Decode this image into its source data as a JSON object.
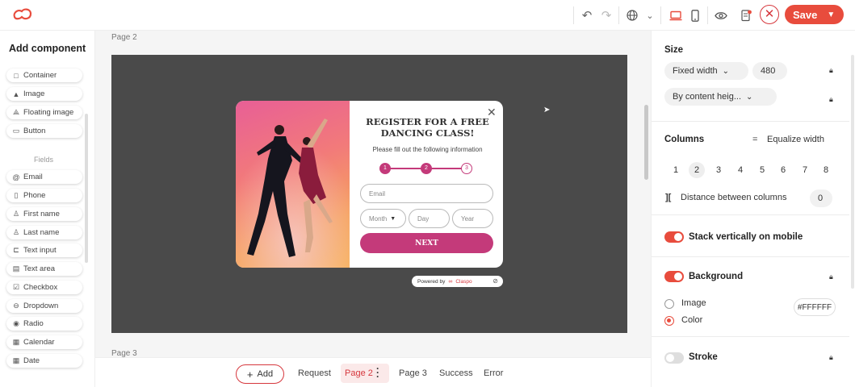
{
  "topbar": {
    "save_label": "Save",
    "brand_color": "#e84c3d"
  },
  "left_panel": {
    "title": "Add component",
    "components": [
      {
        "label": "Container",
        "icon": "square-icon"
      },
      {
        "label": "Image",
        "icon": "image-icon"
      },
      {
        "label": "Floating image",
        "icon": "floating-image-icon"
      },
      {
        "label": "Button",
        "icon": "button-icon"
      }
    ],
    "fields_label": "Fields",
    "fields": [
      {
        "label": "Email",
        "icon": "at-icon"
      },
      {
        "label": "Phone",
        "icon": "phone-icon"
      },
      {
        "label": "First name",
        "icon": "person-icon"
      },
      {
        "label": "Last name",
        "icon": "person-icon"
      },
      {
        "label": "Text input",
        "icon": "text-input-icon"
      },
      {
        "label": "Text area",
        "icon": "text-area-icon"
      },
      {
        "label": "Checkbox",
        "icon": "checkbox-icon"
      },
      {
        "label": "Dropdown",
        "icon": "dropdown-icon"
      },
      {
        "label": "Radio",
        "icon": "radio-icon"
      },
      {
        "label": "Calendar",
        "icon": "calendar-icon"
      },
      {
        "label": "Date",
        "icon": "date-icon"
      }
    ]
  },
  "canvas": {
    "page_label_top": "Page 2",
    "page_label_bottom": "Page 3",
    "popup": {
      "title": "REGISTER FOR A FREE DANCING CLASS!",
      "subtitle": "Please fill out the following information",
      "steps": [
        "1",
        "2",
        "3"
      ],
      "email_placeholder": "Email",
      "month_placeholder": "Month",
      "day_placeholder": "Day",
      "year_placeholder": "Year",
      "next_label": "NEXT",
      "accent": "#c43a7a"
    },
    "powered_by": "Powered by",
    "powered_brand": "Claspo"
  },
  "bottom_bar": {
    "add_label": "Add",
    "tabs": [
      "Request",
      "Page 2",
      "Page 3",
      "Success",
      "Error"
    ],
    "active_tab": "Page 2"
  },
  "right_panel": {
    "size_title": "Size",
    "width_mode": "Fixed width",
    "width_value": "480",
    "height_mode": "By content heig...",
    "columns_title": "Columns",
    "equalize_label": "Equalize width",
    "column_options": [
      "1",
      "2",
      "3",
      "4",
      "5",
      "6",
      "7",
      "8"
    ],
    "selected_column": "2",
    "distance_label": "Distance between columns",
    "distance_value": "0",
    "stack_label": "Stack vertically on mobile",
    "background_label": "Background",
    "image_option": "Image",
    "color_option": "Color",
    "color_value": "#FFFFFF",
    "stroke_label": "Stroke"
  }
}
